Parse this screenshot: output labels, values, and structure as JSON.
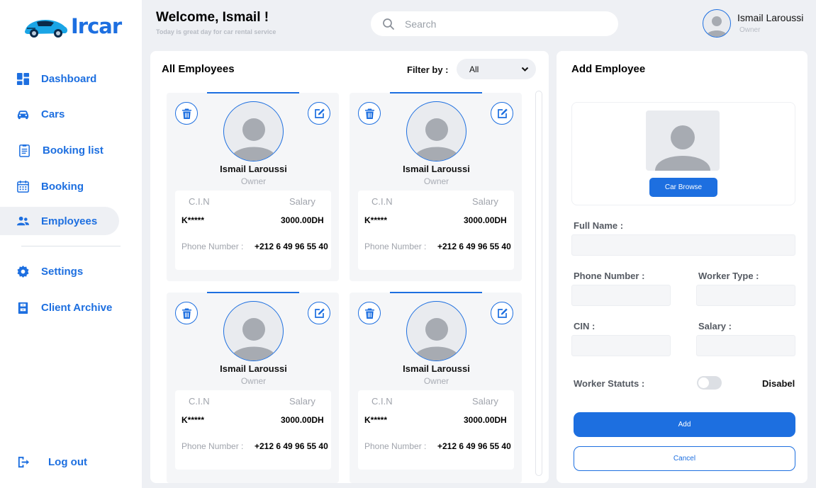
{
  "brand": {
    "name": "Ircar"
  },
  "header": {
    "title": "Welcome, Ismail !",
    "subtitle": "Today is great day for car rental service",
    "search_placeholder": "Search",
    "user_name": "Ismail Laroussi",
    "user_role": "Owner"
  },
  "sidebar": {
    "items": [
      {
        "label": "Dashboard",
        "icon": "dashboard-icon"
      },
      {
        "label": "Cars",
        "icon": "car-icon"
      },
      {
        "label": "Booking list",
        "icon": "clipboard-icon"
      },
      {
        "label": "Booking",
        "icon": "calendar-icon"
      },
      {
        "label": "Employees",
        "icon": "users-icon",
        "active": true
      },
      {
        "label": "Settings",
        "icon": "gear-icon"
      },
      {
        "label": "Client Archive",
        "icon": "archive-icon"
      }
    ],
    "logout_label": "Log out"
  },
  "employees_panel": {
    "title": "All Employees",
    "filter_label": "Filter by :",
    "filter_value": "All",
    "cards": [
      {
        "name": "Ismail Laroussi",
        "role": "Owner",
        "cin_label": "C.I.N",
        "salary_label": "Salary",
        "cin": "K*****",
        "salary": "3000.00DH",
        "phone_label": "Phone Number :",
        "phone": "+212 6 49 96 55 40"
      },
      {
        "name": "Ismail Laroussi",
        "role": "Owner",
        "cin_label": "C.I.N",
        "salary_label": "Salary",
        "cin": "K*****",
        "salary": "3000.00DH",
        "phone_label": "Phone Number :",
        "phone": "+212 6 49 96 55 40"
      },
      {
        "name": "Ismail Laroussi",
        "role": "Owner",
        "cin_label": "C.I.N",
        "salary_label": "Salary",
        "cin": "K*****",
        "salary": "3000.00DH",
        "phone_label": "Phone Number :",
        "phone": "+212 6 49 96 55 40"
      },
      {
        "name": "Ismail Laroussi",
        "role": "Owner",
        "cin_label": "C.I.N",
        "salary_label": "Salary",
        "cin": "K*****",
        "salary": "3000.00DH",
        "phone_label": "Phone Number :",
        "phone": "+212 6 49 96 55 40"
      }
    ]
  },
  "add_panel": {
    "title": "Add Employee",
    "browse_label": "Car Browse",
    "full_name_label": "Full Name :",
    "phone_label": "Phone Number :",
    "worker_type_label": "Worker Type :",
    "cin_label": "CIN :",
    "salary_label": "Salary :",
    "status_label": "Worker Statuts :",
    "status_value": "Disabel",
    "add_label": "Add",
    "cancel_label": "Cancel"
  },
  "colors": {
    "accent": "#1d6fe0",
    "background": "#eef0f4",
    "panel": "#ffffff"
  }
}
